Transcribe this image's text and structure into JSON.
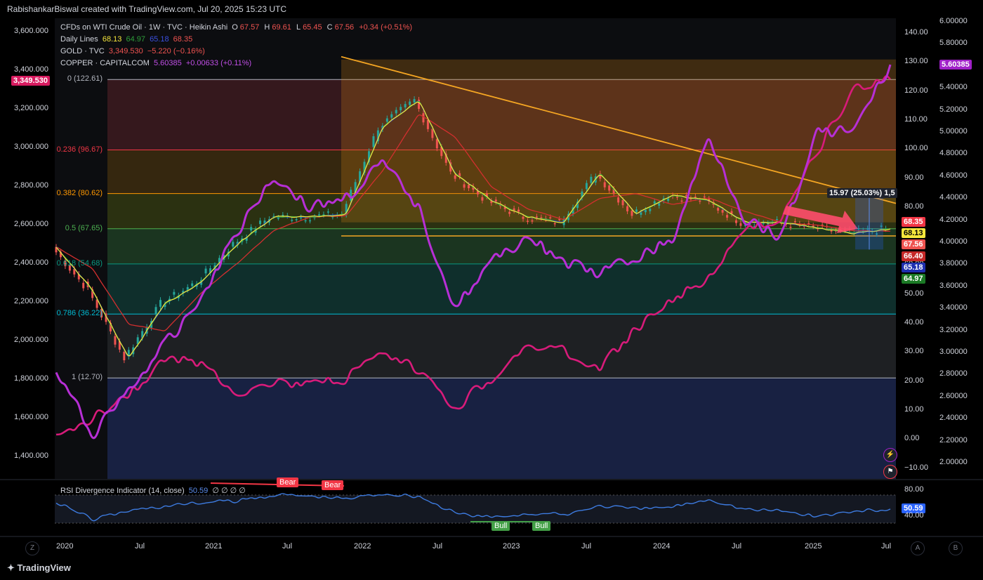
{
  "header": {
    "credit": "RabishankarBiswal created with TradingView.com, Jul 20, 2025 15:23 UTC"
  },
  "legend": {
    "main": {
      "title": "CFDs on WTI Crude Oil · 1W · TVC · Heikin Ashi",
      "o_label": "O",
      "o": "67.57",
      "h_label": "H",
      "h": "69.61",
      "l_label": "L",
      "l": "65.45",
      "c_label": "C",
      "c": "67.56",
      "change": "+0.34 (+0.51%)"
    },
    "daily": {
      "title": "Daily Lines",
      "v1": "68.13",
      "v2": "64.97",
      "v3": "65.18",
      "v4": "68.35"
    },
    "gold": {
      "title": "GOLD · TVC",
      "value": "3,349.530",
      "change": "−5.220 (−0.16%)"
    },
    "copper": {
      "title": "COPPER · CAPITALCOM",
      "value": "5.60385",
      "change": "+0.00633 (+0.11%)"
    }
  },
  "colors": {
    "gold_line": "#d81b7a",
    "copper_line": "#b72fd6",
    "trend": "#f5a623",
    "ma_yellow": "#f5e63c",
    "ma_green": "#2e9e3a",
    "ma_blue": "#2234c9",
    "ma_red": "#d32f2f",
    "up": "#26a69a",
    "down": "#ef5350",
    "rsi": "#3d7be0"
  },
  "gold_axis": [
    "3,600.000",
    "3,400.000",
    "3,200.000",
    "3,000.000",
    "2,800.000",
    "2,600.000",
    "2,400.000",
    "2,200.000",
    "2,000.000",
    "1,800.000",
    "1,600.000",
    "1,400.000"
  ],
  "oil_axis": [
    "140.00",
    "130.00",
    "120.00",
    "110.00",
    "100.00",
    "90.00",
    "80.00",
    "70.00",
    "60.00",
    "50.00",
    "40.00",
    "30.00",
    "20.00",
    "10.00",
    "0.00",
    "−10.00"
  ],
  "copper_axis": [
    "6.00000",
    "5.80000",
    "5.60000",
    "5.40000",
    "5.20000",
    "5.00000",
    "4.80000",
    "4.60000",
    "4.40000",
    "4.20000",
    "4.00000",
    "3.80000",
    "3.60000",
    "3.40000",
    "3.20000",
    "3.00000",
    "2.80000",
    "2.60000",
    "2.40000",
    "2.20000",
    "2.00000"
  ],
  "tags": {
    "gold": "3,349.530",
    "copper": "5.60385",
    "oil": [
      "68.35",
      "68.13",
      "67.56",
      "66.40",
      "65.18",
      "64.97"
    ],
    "rsi": "50.59"
  },
  "fib_levels": [
    {
      "label": "0 (122.61)",
      "color": "#b2b5be"
    },
    {
      "label": "0.236 (96.67)",
      "color": "#f23645"
    },
    {
      "label": "0.382 (80.62)",
      "color": "#ff9800"
    },
    {
      "label": "0.5 (67.65)",
      "color": "#4caf50"
    },
    {
      "label": "0.618 (54.68)",
      "color": "#089981"
    },
    {
      "label": "0.786 (36.22)",
      "color": "#00bcd4"
    },
    {
      "label": "1 (12.70)",
      "color": "#b2b5be"
    }
  ],
  "measure_label": "15.97 (25.03%) 1,5",
  "rsi": {
    "title": "RSI Divergence Indicator (14, close)",
    "value": "50.59",
    "zeros": "∅ ∅ ∅ ∅",
    "axis": [
      "80.00",
      "40.00"
    ],
    "bear": [
      "Bear",
      "Bear"
    ],
    "bull": [
      "Bull",
      "Bull"
    ]
  },
  "x_labels": [
    "2020",
    "Jul",
    "2021",
    "Jul",
    "2022",
    "Jul",
    "2023",
    "Jul",
    "2024",
    "Jul",
    "2025",
    "Jul"
  ],
  "footer": "TradingView",
  "buttons": {
    "left": "Z",
    "auto": "A",
    "log": "B"
  },
  "chart_data": {
    "type": "line",
    "title": "CFDs on WTI Crude Oil · 1W · TVC · Heikin Ashi",
    "x": [
      "2019-12",
      "2020-03",
      "2020-06",
      "2020-09",
      "2020-12",
      "2021-03",
      "2021-06",
      "2021-09",
      "2021-12",
      "2022-03",
      "2022-06",
      "2022-09",
      "2022-12",
      "2023-03",
      "2023-06",
      "2023-09",
      "2023-12",
      "2024-03",
      "2024-06",
      "2024-09",
      "2024-12",
      "2025-03",
      "2025-06",
      "2025-07"
    ],
    "series": [
      {
        "name": "CFDs on WTI Crude Oil",
        "axis": "oil",
        "values": [
          61,
          45,
          20,
          40,
          48,
          62,
          72,
          72,
          73,
          105,
          115,
          88,
          78,
          72,
          70,
          88,
          73,
          80,
          78,
          70,
          70,
          68,
          66,
          67.56
        ]
      },
      {
        "name": "GOLD · TVC",
        "axis": "gold",
        "values": [
          1480,
          1600,
          1720,
          1900,
          1880,
          1730,
          1780,
          1760,
          1800,
          1920,
          1840,
          1650,
          1800,
          1970,
          1940,
          1850,
          2060,
          2200,
          2330,
          2560,
          2640,
          2980,
          3300,
          3349.53
        ]
      },
      {
        "name": "COPPER · CAPITALCOM",
        "axis": "copper",
        "values": [
          2.8,
          2.25,
          2.65,
          3.05,
          3.5,
          4.1,
          4.6,
          4.3,
          4.4,
          4.7,
          4.3,
          3.4,
          3.8,
          4.05,
          3.8,
          3.7,
          3.85,
          4.0,
          4.95,
          4.2,
          4.05,
          5.0,
          5.0,
          5.60385
        ]
      }
    ],
    "fib_retracement": {
      "0": 122.61,
      "0.236": 96.67,
      "0.382": 80.62,
      "0.5": 67.65,
      "0.618": 54.68,
      "0.786": 36.22,
      "1": 12.7
    },
    "oil_ylim": [
      -15,
      145
    ],
    "gold_ylim": [
      1300,
      3700
    ],
    "copper_ylim": [
      1.9,
      6.05
    ],
    "rsi_values": [
      62,
      35,
      48,
      55,
      60,
      63,
      72,
      70,
      66,
      74,
      70,
      44,
      38,
      44,
      42,
      56,
      50,
      54,
      66,
      50,
      48,
      40,
      47,
      50.59
    ]
  }
}
